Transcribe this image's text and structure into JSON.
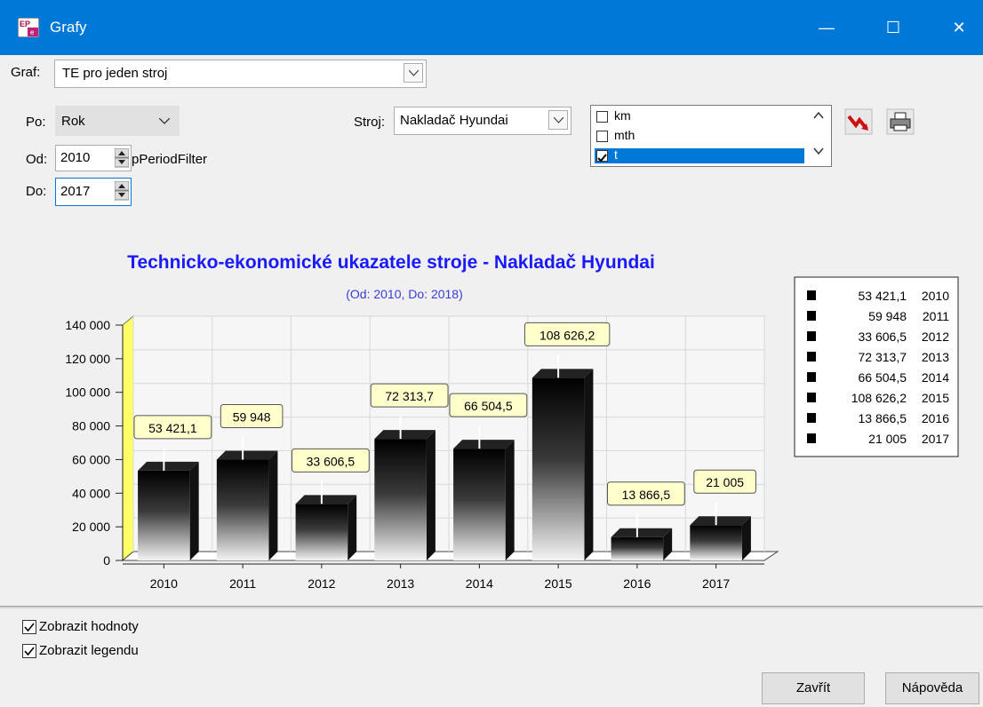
{
  "window": {
    "title": "Grafy",
    "minimize": "—",
    "maximize": "☐",
    "close": "✕"
  },
  "form": {
    "graf_label": "Graf:",
    "graf_value": "TE pro jeden stroj",
    "po_label": "Po:",
    "po_value": "Rok",
    "od_label": "Od:",
    "od_value": "2010",
    "period_filter": "pPeriodFilter",
    "do_label": "Do:",
    "do_value": "2017",
    "stroj_label": "Stroj:",
    "stroj_value": "Nakladač Hyundai",
    "units": [
      {
        "label": "km",
        "checked": false,
        "selected": false
      },
      {
        "label": "mth",
        "checked": false,
        "selected": false
      },
      {
        "label": "t",
        "checked": true,
        "selected": true
      }
    ]
  },
  "chart_data": {
    "type": "bar",
    "title": "Technicko-ekonomické ukazatele stroje - Nakladač Hyundai",
    "subtitle": "(Od: 2010, Do: 2018)",
    "categories": [
      "2010",
      "2011",
      "2012",
      "2013",
      "2014",
      "2015",
      "2016",
      "2017"
    ],
    "values": [
      53421.1,
      59948,
      33606.5,
      72313.7,
      66504.5,
      108626.2,
      13866.5,
      21005
    ],
    "value_labels": [
      "53 421,1",
      "59 948",
      "33 606,5",
      "72 313,7",
      "66 504,5",
      "108 626,2",
      "13 866,5",
      "21 005"
    ],
    "y_ticks": [
      "0",
      "20 000",
      "40 000",
      "60 000",
      "80 000",
      "100 000",
      "120 000",
      "140 000"
    ],
    "ylim": [
      0,
      140000
    ],
    "grid": true,
    "legend": "right",
    "title_color": "#1a1aff",
    "subtitle_color": "#3b3bd8"
  },
  "options": {
    "show_values_label": "Zobrazit hodnoty",
    "show_values": true,
    "show_legend_label": "Zobrazit legendu",
    "show_legend": true
  },
  "buttons": {
    "close": "Zavřít",
    "help": "Nápověda"
  },
  "icons": {
    "app": "app-icon",
    "export": "export-icon",
    "print": "printer-icon"
  }
}
